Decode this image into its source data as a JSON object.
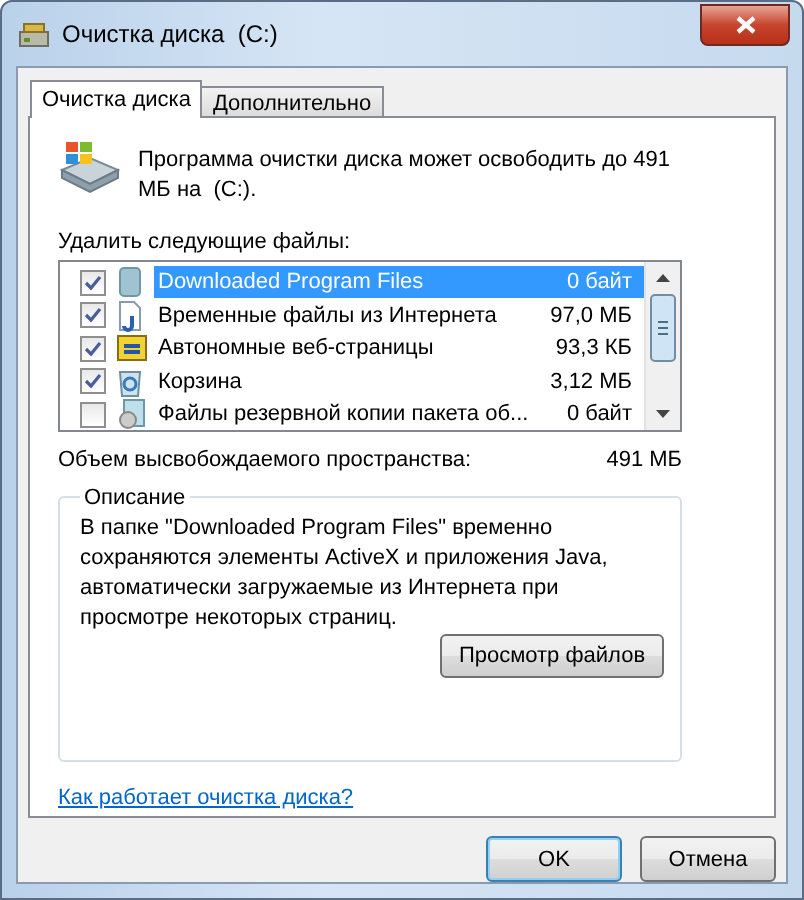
{
  "window": {
    "title": "Очистка диска  (C:)"
  },
  "tabs": [
    {
      "label": "Очистка диска",
      "selected": true
    },
    {
      "label": "Дополнительно",
      "selected": false
    }
  ],
  "intro": "Программа очистки диска может освободить до 491 МБ на  (C:).",
  "files_label": "Удалить следующие файлы:",
  "files": [
    {
      "kind": "folder",
      "name": "Downloaded Program Files",
      "size": "0 байт",
      "checked": true,
      "selected": true
    },
    {
      "kind": "page",
      "name": "Временные файлы из Интернета",
      "size": "97,0 МБ",
      "checked": true,
      "selected": false
    },
    {
      "kind": "web",
      "name": "Автономные веб-страницы",
      "size": "93,3 КБ",
      "checked": true,
      "selected": false
    },
    {
      "kind": "recycle",
      "name": "Корзина",
      "size": "3,12 МБ",
      "checked": true,
      "selected": false
    },
    {
      "kind": "backup",
      "name": "Файлы резервной копии пакета об...",
      "size": "0 байт",
      "checked": false,
      "selected": false
    }
  ],
  "total": {
    "label": "Объем высвобождаемого пространства:",
    "value": "491 МБ"
  },
  "description": {
    "title": "Описание",
    "text": "В папке \"Downloaded Program Files\" временно сохраняются элементы ActiveX и приложения Java, автоматически загружаемые из Интернета при просмотре некоторых страниц.",
    "button": "Просмотр файлов"
  },
  "help_link": "Как работает очистка диска?",
  "buttons": [
    {
      "label": "OK",
      "default": true
    },
    {
      "label": "Отмена",
      "default": false
    }
  ]
}
